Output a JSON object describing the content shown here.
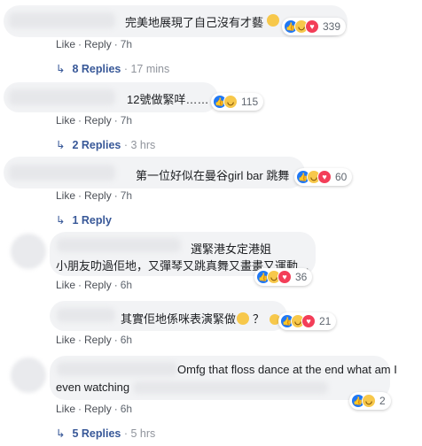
{
  "action_labels": {
    "like": "Like",
    "reply": "Reply"
  },
  "comments": [
    {
      "text": "完美地展現了自己沒有才藝",
      "reactions": "339",
      "time": "7h",
      "replies_label": "8 Replies",
      "replies_time": "17 mins"
    },
    {
      "text": "12號做緊咩……",
      "reactions": "115",
      "time": "7h",
      "replies_label": "2 Replies",
      "replies_time": "3 hrs"
    },
    {
      "text": "第一位好似在曼谷girl bar 跳舞",
      "reactions": "60",
      "time": "7h",
      "replies_label": "1 Reply",
      "replies_time": ""
    },
    {
      "text": "選緊港女定港姐",
      "text2": "小朋友叻過佢地，又彈琴又跳真舞又畫畫又運動…",
      "reactions": "36",
      "time": "6h"
    },
    {
      "text": "其實佢地係咪表演緊做",
      "text_suffix": "？",
      "reactions": "21",
      "time": "6h"
    },
    {
      "text": "Omfg that floss dance at the end what am I",
      "text2": "even watching",
      "reactions": "2",
      "time": "6h",
      "replies_label": "5 Replies",
      "replies_time": "5 hrs"
    }
  ],
  "colors": {
    "like": "#2078f4",
    "haha": "#f7c84b",
    "love": "#f33e58",
    "link": "#385898",
    "bubble": "#f2f3f5"
  },
  "icons": [
    "like-reaction-icon",
    "haha-reaction-icon",
    "love-reaction-icon",
    "reply-arrow-icon",
    "thinking-emoji-icon"
  ]
}
